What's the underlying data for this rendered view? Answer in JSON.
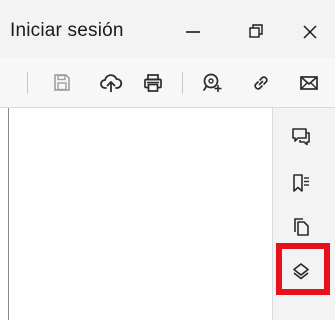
{
  "window": {
    "title": "Iniciar sesión",
    "controls": {
      "minimize": "minimize-icon",
      "restore": "restore-icon",
      "close": "close-icon"
    }
  },
  "toolbar": {
    "icons": [
      "save-icon",
      "cloud-upload-icon",
      "print-icon",
      "zoom-add-icon",
      "link-icon",
      "mail-icon"
    ]
  },
  "sidebar": {
    "icons": [
      "comments-icon",
      "bookmarks-icon",
      "pages-icon",
      "layers-icon"
    ],
    "highlighted": "layers-icon"
  },
  "colors": {
    "highlight": "#e8111b",
    "icon": "#2b2b2b",
    "disabled_icon": "#9a9a9a"
  }
}
